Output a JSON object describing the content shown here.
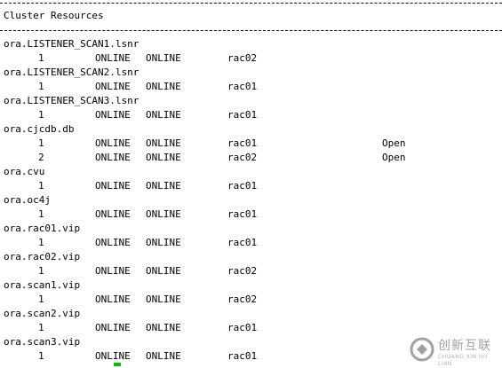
{
  "terminal": {
    "section_title": "Cluster Resources",
    "resources": [
      {
        "name": "ora.LISTENER_SCAN1.lsnr",
        "instances": [
          {
            "num": "1",
            "target": "ONLINE",
            "state": "ONLINE",
            "server": "rac02",
            "details": ""
          }
        ]
      },
      {
        "name": "ora.LISTENER_SCAN2.lsnr",
        "instances": [
          {
            "num": "1",
            "target": "ONLINE",
            "state": "ONLINE",
            "server": "rac01",
            "details": ""
          }
        ]
      },
      {
        "name": "ora.LISTENER_SCAN3.lsnr",
        "instances": [
          {
            "num": "1",
            "target": "ONLINE",
            "state": "ONLINE",
            "server": "rac01",
            "details": ""
          }
        ]
      },
      {
        "name": "ora.cjcdb.db",
        "instances": [
          {
            "num": "1",
            "target": "ONLINE",
            "state": "ONLINE",
            "server": "rac01",
            "details": "Open"
          },
          {
            "num": "2",
            "target": "ONLINE",
            "state": "ONLINE",
            "server": "rac02",
            "details": "Open"
          }
        ]
      },
      {
        "name": "ora.cvu",
        "instances": [
          {
            "num": "1",
            "target": "ONLINE",
            "state": "ONLINE",
            "server": "rac01",
            "details": ""
          }
        ]
      },
      {
        "name": "ora.oc4j",
        "instances": [
          {
            "num": "1",
            "target": "ONLINE",
            "state": "ONLINE",
            "server": "rac01",
            "details": ""
          }
        ]
      },
      {
        "name": "ora.rac01.vip",
        "instances": [
          {
            "num": "1",
            "target": "ONLINE",
            "state": "ONLINE",
            "server": "rac01",
            "details": ""
          }
        ]
      },
      {
        "name": "ora.rac02.vip",
        "instances": [
          {
            "num": "1",
            "target": "ONLINE",
            "state": "ONLINE",
            "server": "rac02",
            "details": ""
          }
        ]
      },
      {
        "name": "ora.scan1.vip",
        "instances": [
          {
            "num": "1",
            "target": "ONLINE",
            "state": "ONLINE",
            "server": "rac02",
            "details": ""
          }
        ]
      },
      {
        "name": "ora.scan2.vip",
        "instances": [
          {
            "num": "1",
            "target": "ONLINE",
            "state": "ONLINE",
            "server": "rac01",
            "details": ""
          }
        ]
      },
      {
        "name": "ora.scan3.vip",
        "instances": [
          {
            "num": "1",
            "target": "ONLINE",
            "state": "ONLINE",
            "server": "rac01",
            "details": ""
          }
        ]
      }
    ],
    "cursor_color": "#00c000"
  },
  "watermark": {
    "brand_text": "创新互联",
    "sub_text": "CHUANG XIN HU LIAN",
    "icon": "brand-logo-icon"
  }
}
